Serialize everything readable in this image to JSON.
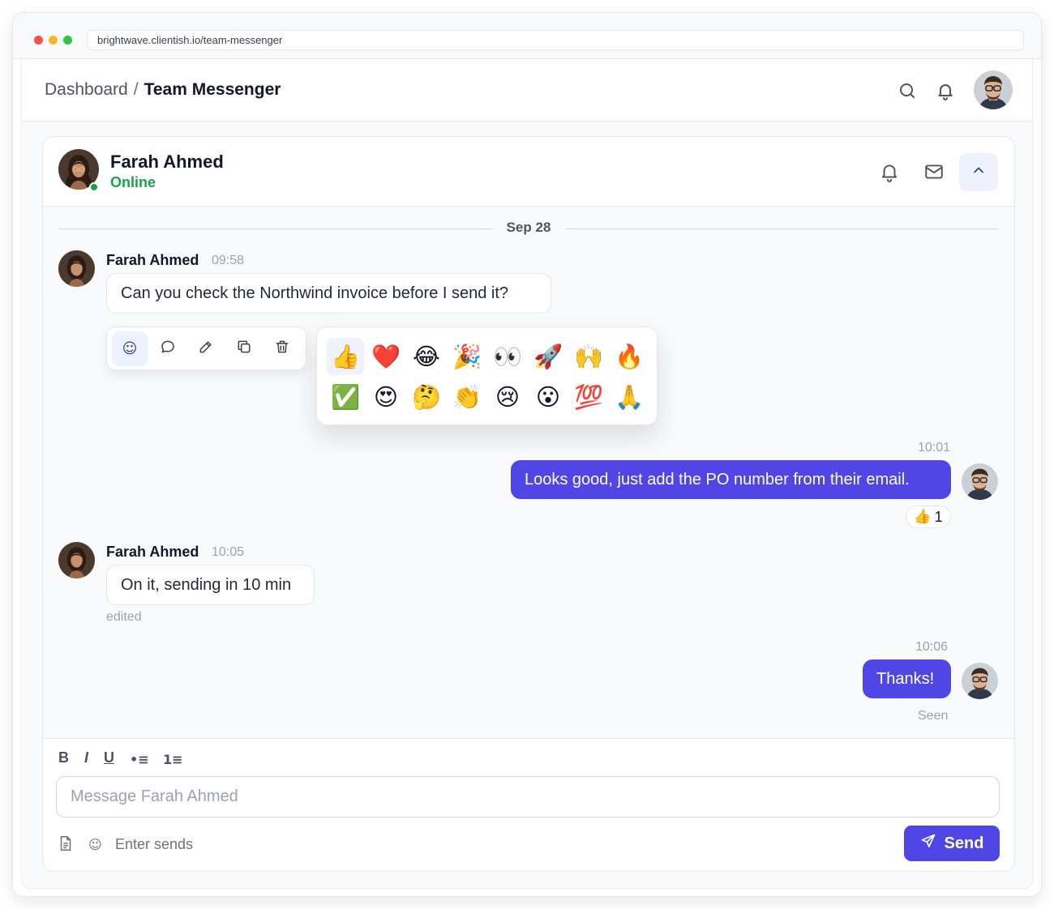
{
  "browser": {
    "url": "brightwave.clientish.io/team-messenger"
  },
  "header": {
    "breadcrumb_root": "Dashboard",
    "breadcrumb_separator": "/",
    "breadcrumb_current": "Team Messenger",
    "icons": [
      "search-icon",
      "bell-icon"
    ]
  },
  "contact": {
    "name": "Farah Ahmed",
    "status": "Online",
    "status_color": "#16a34a"
  },
  "chat": {
    "date_divider": "Sep 28",
    "messages": [
      {
        "sender": "Farah Ahmed",
        "time": "09:58",
        "text": "Can you check the Northwind invoice before I send it?"
      },
      {
        "time": "10:01",
        "text": "Looks good, just add the PO number from their email.",
        "reaction": {
          "emoji": "👍",
          "count": "1"
        }
      },
      {
        "sender": "Farah Ahmed",
        "time": "10:05",
        "text": "On it, sending in 10 min",
        "note": "edited"
      },
      {
        "time": "10:06",
        "text": "Thanks!",
        "status": "Seen"
      }
    ]
  },
  "message_toolbar": {
    "icons": [
      "smiley-icon",
      "reply-icon",
      "edit-icon",
      "copy-icon",
      "trash-icon"
    ],
    "react_glyph": "☺"
  },
  "emoji_picker": {
    "emojis": [
      "👍",
      "❤️",
      "😂",
      "🎉",
      "👀",
      "🚀",
      "🙌",
      "🔥",
      "✅",
      "😍",
      "🤔",
      "👏",
      "😢",
      "😮",
      "💯",
      "🙏"
    ]
  },
  "composer": {
    "format_buttons": {
      "bold": "B",
      "italic": "I",
      "underline": "U",
      "bullet": "•≡",
      "numbered": "1≡"
    },
    "placeholder": "Message Farah Ahmed",
    "emoji_glyph": "☺",
    "hint": "Enter sends",
    "send_label": "Send"
  },
  "colors": {
    "accent": "#4f46e5",
    "accent_soft": "#eef2ff",
    "online": "#16a34a"
  }
}
